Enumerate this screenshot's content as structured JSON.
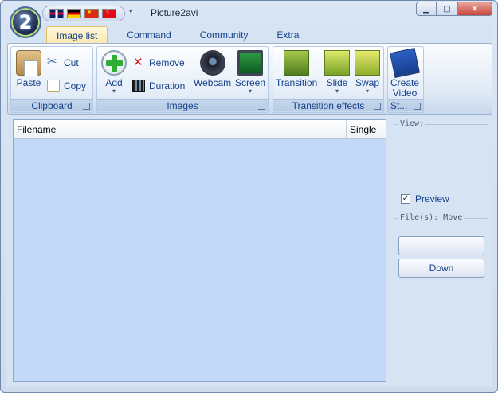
{
  "window": {
    "title": "Picture2avi",
    "logo_text": "2",
    "min_icon": "▁",
    "max_icon": "▢",
    "close_icon": "✕"
  },
  "qat": {
    "flags": [
      "uk-flag",
      "germany-flag",
      "china-flag",
      "turkey-flag"
    ],
    "dropdown_icon": "▾"
  },
  "tabs": [
    "Image list",
    "Command",
    "Community",
    "Extra"
  ],
  "ribbon": {
    "clipboard": {
      "label": "Clipboard",
      "paste": "Paste",
      "cut": "Cut",
      "copy": "Copy"
    },
    "images": {
      "label": "Images",
      "add": "Add",
      "remove": "Remove",
      "duration": "Duration",
      "webcam": "Webcam",
      "screen": "Screen"
    },
    "transition_effects": {
      "label": "Transition effects",
      "transition": "Transition",
      "slide": "Slide",
      "swap": "Swap"
    },
    "st": {
      "label": "St...",
      "create_video_line1": "Create",
      "create_video_line2": "Video"
    },
    "caret": "▾"
  },
  "list": {
    "columns": [
      "Filename",
      "Single"
    ]
  },
  "view_panel": {
    "legend": "View:",
    "preview_label": "Preview",
    "preview_checked": "✓"
  },
  "files_panel": {
    "legend": "File(s): Move",
    "up_label": "",
    "down_label": "Down"
  }
}
